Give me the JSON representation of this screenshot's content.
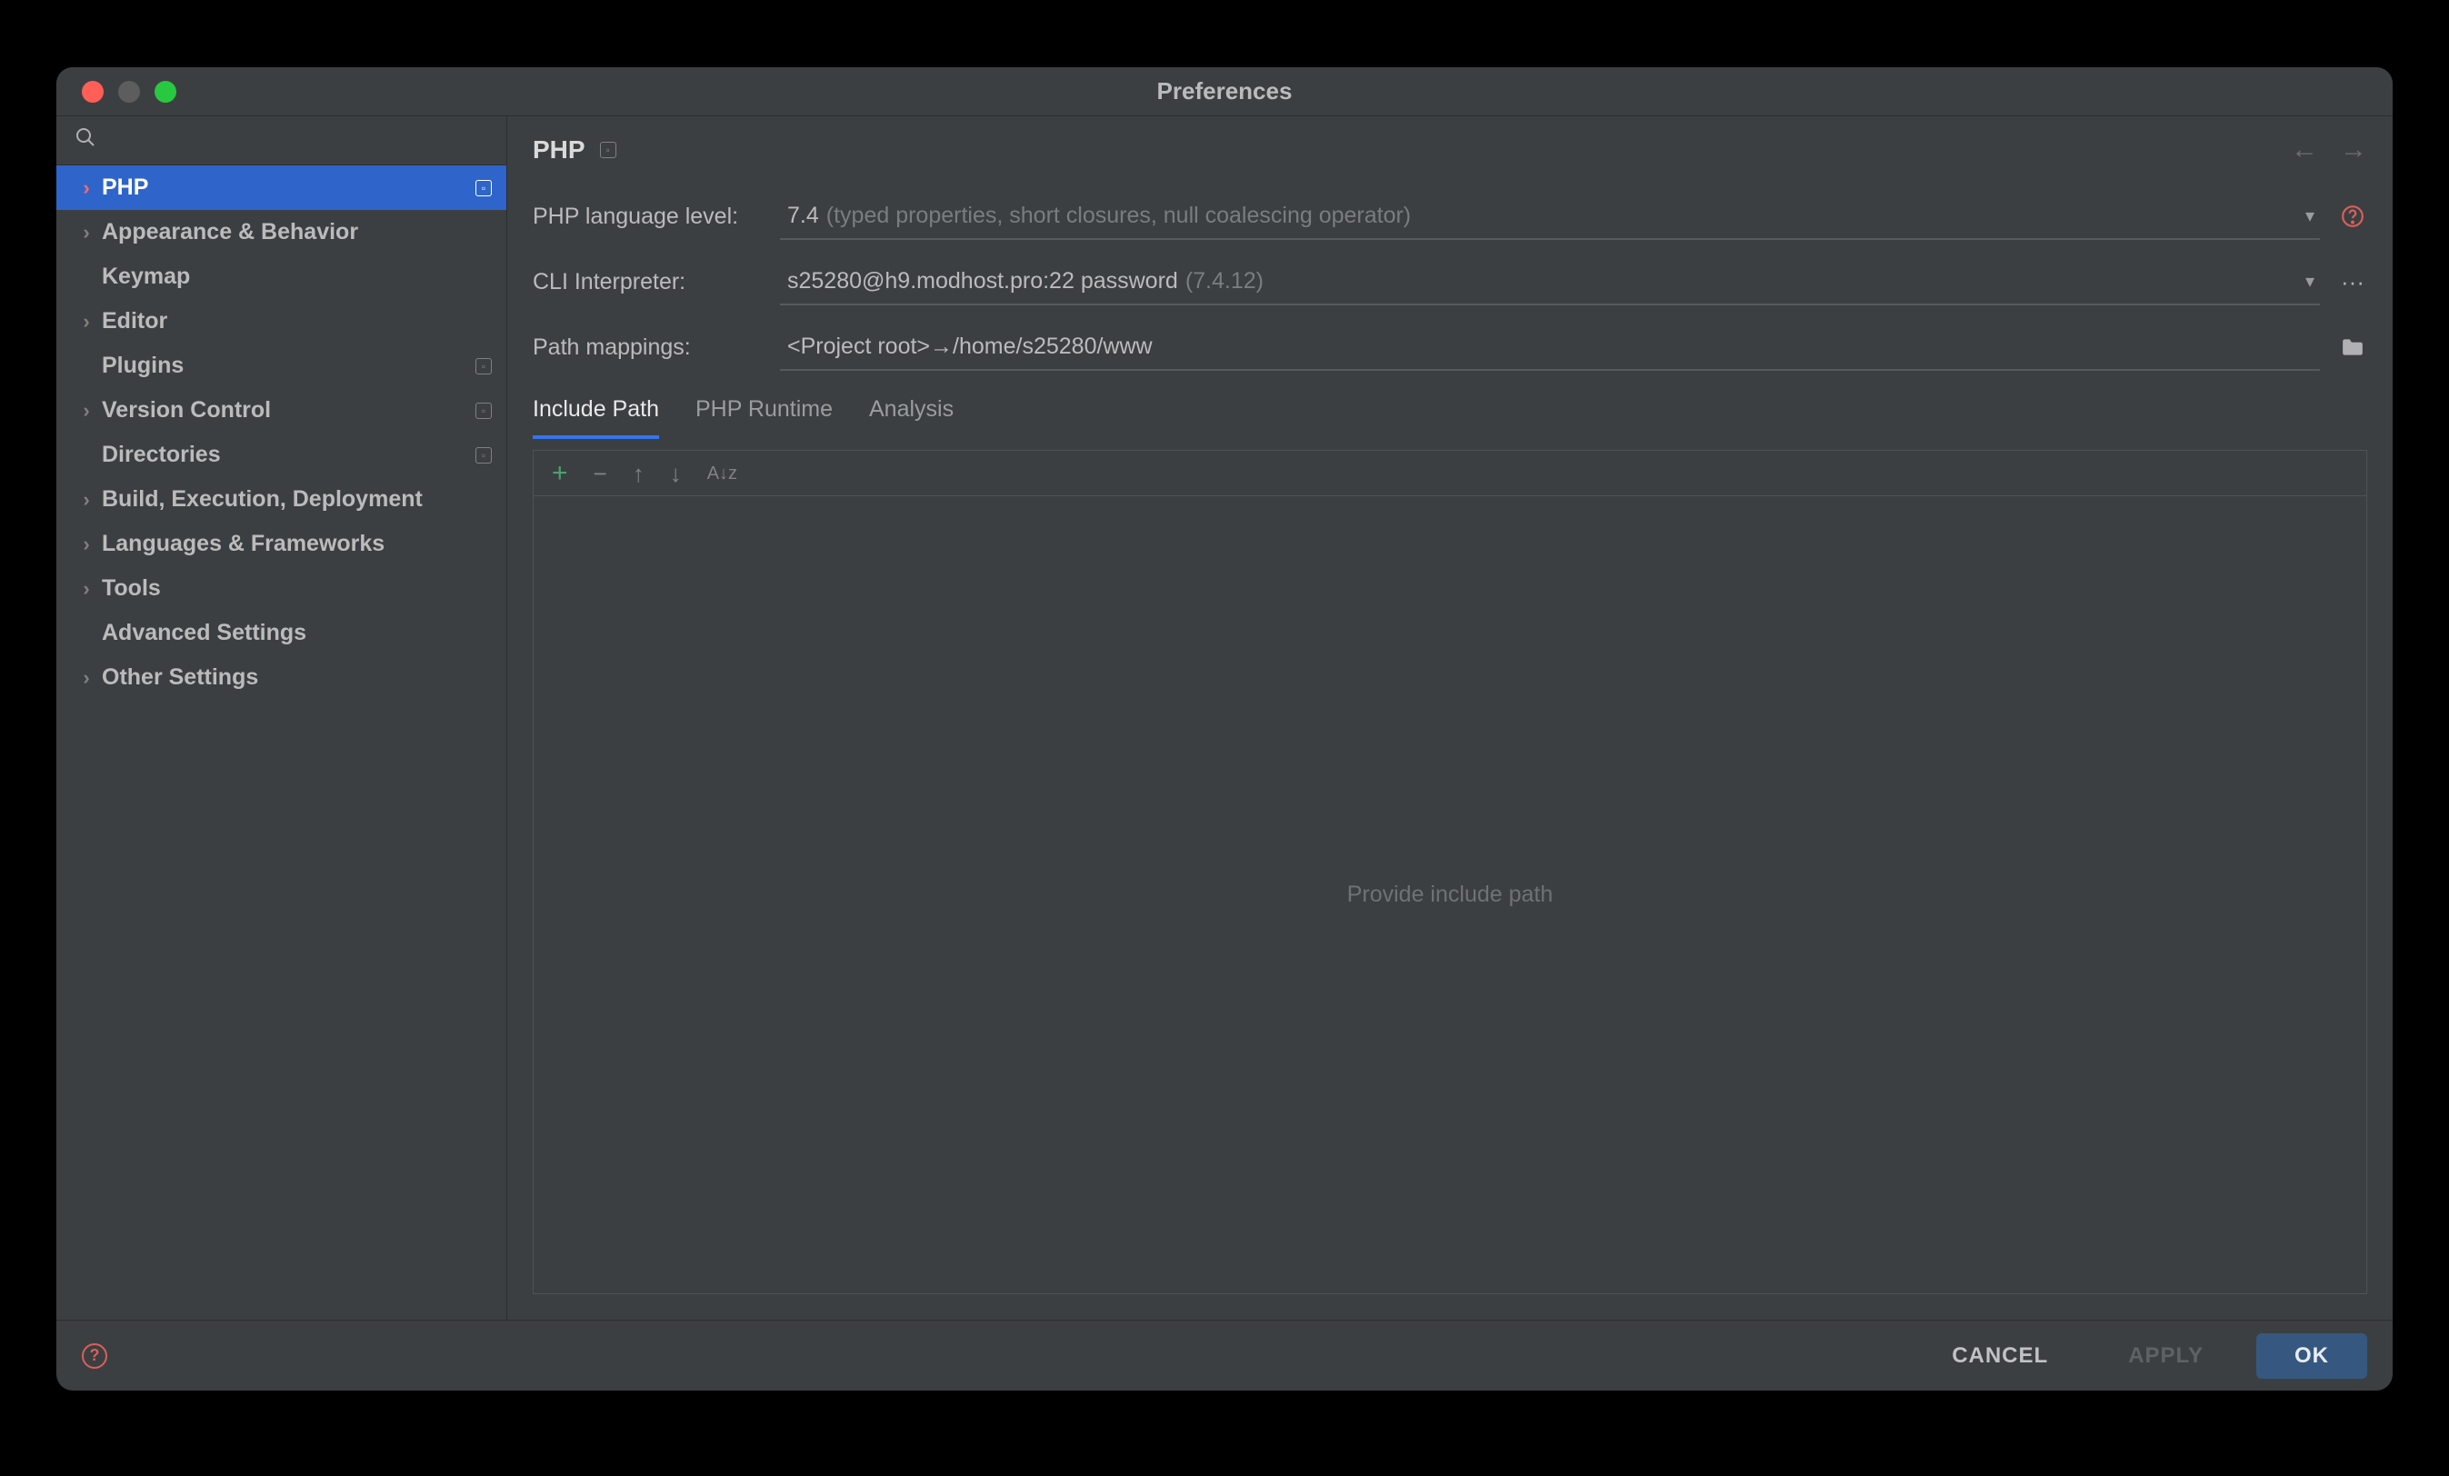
{
  "window": {
    "title": "Preferences"
  },
  "sidebar": {
    "search_placeholder": "",
    "items": [
      {
        "label": "PHP",
        "chev": "right",
        "selected": true,
        "for_project": true
      },
      {
        "label": "Appearance & Behavior",
        "chev": "right",
        "selected": false,
        "for_project": false
      },
      {
        "label": "Keymap",
        "chev": "",
        "selected": false,
        "for_project": false
      },
      {
        "label": "Editor",
        "chev": "right",
        "selected": false,
        "for_project": false
      },
      {
        "label": "Plugins",
        "chev": "",
        "selected": false,
        "for_project": true
      },
      {
        "label": "Version Control",
        "chev": "right",
        "selected": false,
        "for_project": true
      },
      {
        "label": "Directories",
        "chev": "",
        "selected": false,
        "for_project": true
      },
      {
        "label": "Build, Execution, Deployment",
        "chev": "right",
        "selected": false,
        "for_project": false
      },
      {
        "label": "Languages & Frameworks",
        "chev": "right",
        "selected": false,
        "for_project": false
      },
      {
        "label": "Tools",
        "chev": "right",
        "selected": false,
        "for_project": false
      },
      {
        "label": "Advanced Settings",
        "chev": "",
        "selected": false,
        "for_project": false
      },
      {
        "label": "Other Settings",
        "chev": "right",
        "selected": false,
        "for_project": false
      }
    ]
  },
  "main": {
    "breadcrumb": "PHP",
    "fields": {
      "lang_level": {
        "label": "PHP language level:",
        "value": "7.4",
        "hint": "(typed properties, short closures, null coalescing operator)"
      },
      "interpreter": {
        "label": "CLI Interpreter:",
        "value": "s25280@h9.modhost.pro:22 password",
        "hint": "(7.4.12)"
      },
      "mappings": {
        "label": "Path mappings:",
        "value": "<Project root>→/home/s25280/www"
      }
    },
    "tabs": [
      "Include Path",
      "PHP Runtime",
      "Analysis"
    ],
    "active_tab": 0,
    "include_placeholder": "Provide include path"
  },
  "footer": {
    "cancel": "CANCEL",
    "apply": "APPLY",
    "ok": "OK"
  }
}
